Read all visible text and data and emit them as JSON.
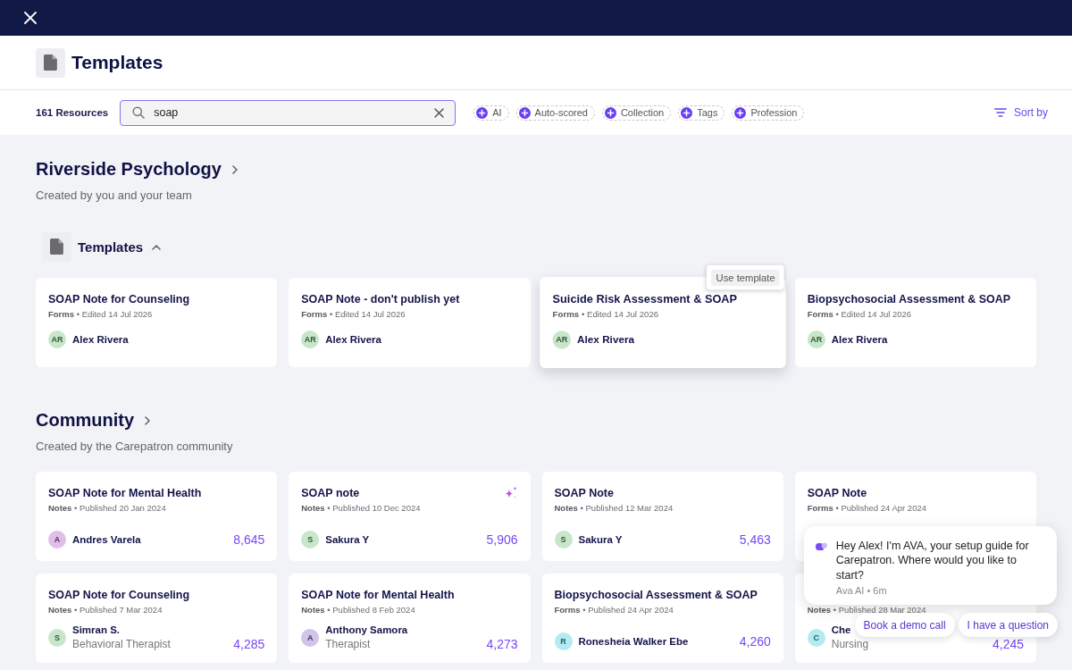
{
  "header": {
    "title": "Templates"
  },
  "toolbar": {
    "resource_count": "161 Resources",
    "search": {
      "value": "soap"
    },
    "filters": [
      "AI",
      "Auto-scored",
      "Collection",
      "Tags",
      "Profession"
    ],
    "sort": "Sort by"
  },
  "sections": [
    {
      "title": "Riverside Psychology",
      "subtitle": "Created by you and your team",
      "groups": [
        {
          "title": "Templates",
          "expanded": true,
          "cards": [
            {
              "title": "SOAP Note for Counseling",
              "meta": "**Forms** • Edited 14 Jul 2026",
              "author": {
                "initials": "AR",
                "name": "Alex Rivera",
                "color": "#c8e6c9"
              },
              "hovered": false
            },
            {
              "title": "SOAP Note - don't publish yet",
              "meta": "**Forms** • Edited 14 Jul 2026",
              "author": {
                "initials": "AR",
                "name": "Alex Rivera",
                "color": "#c8e6c9"
              },
              "hovered": false
            },
            {
              "title": "Suicide Risk Assessment & SOAP",
              "meta": "**Forms** • Edited 14 Jul 2026",
              "author": {
                "initials": "AR",
                "name": "Alex Rivera",
                "color": "#c8e6c9"
              },
              "hovered": true,
              "tooltip": "Use template"
            },
            {
              "title": "Biopsychosocial Assessment & SOAP",
              "meta": "**Forms** • Edited 14 Jul 2026",
              "author": {
                "initials": "AR",
                "name": "Alex Rivera",
                "color": "#c8e6c9"
              },
              "hovered": false
            }
          ]
        }
      ]
    },
    {
      "title": "Community",
      "subtitle": "Created by the Carepatron community",
      "cards": [
        {
          "title": "SOAP Note for Mental Health",
          "meta": "**Notes** • Published 20 Jan 2024",
          "author": {
            "initials": "A",
            "name": "Andres Varela",
            "color": "#e1bee7"
          },
          "count": "8,645",
          "ai": false
        },
        {
          "title": "SOAP note",
          "meta": "**Notes** • Published 10 Dec 2024",
          "author": {
            "initials": "S",
            "name": "Sakura Y",
            "color": "#c8e6c9"
          },
          "count": "5,906",
          "ai": true
        },
        {
          "title": "SOAP Note",
          "meta": "**Notes** • Published 12 Mar 2024",
          "author": {
            "initials": "S",
            "name": "Sakura Y",
            "color": "#c8e6c9"
          },
          "count": "5,463",
          "ai": false
        },
        {
          "title": "SOAP Note",
          "meta": "**Forms** • Published 24 Apr 2024",
          "ai": false
        },
        {
          "title": "SOAP Note for Counseling",
          "meta": "**Notes** • Published 7 Mar 2024",
          "author": {
            "initials": "S",
            "name": "Simran S.",
            "role": "Behavioral Therapist",
            "color": "#c8e6c9"
          },
          "count": "4,285",
          "ai": false
        },
        {
          "title": "SOAP Note for Mental Health",
          "meta": "**Notes** • Published 8 Feb 2024",
          "author": {
            "initials": "A",
            "name": "Anthony Samora",
            "role": "Therapist",
            "color": "#d1c4e9"
          },
          "count": "4,273",
          "ai": false
        },
        {
          "title": "Biopsychosocial Assessment & SOAP",
          "meta": "**Forms** • Published 24 Apr 2024",
          "author": {
            "initials": "R",
            "name": "Ronesheia Walker Ebe",
            "color": "#b2ebf2"
          },
          "count": "4,260",
          "ai": false
        },
        {
          "meta": "**Notes** • Published 28 Mar 2024",
          "author": {
            "initials": "C",
            "name": "Che",
            "role": "Nursing",
            "color": "#b2ebf2"
          },
          "count": "4,245",
          "ai": false
        }
      ]
    }
  ],
  "chat": {
    "message": "Hey Alex! I'm AVA, your setup guide for Carepatron. Where would you like to start?",
    "meta": "Ava AI • 6m",
    "actions": [
      "Book a demo call",
      "I have a question"
    ]
  }
}
